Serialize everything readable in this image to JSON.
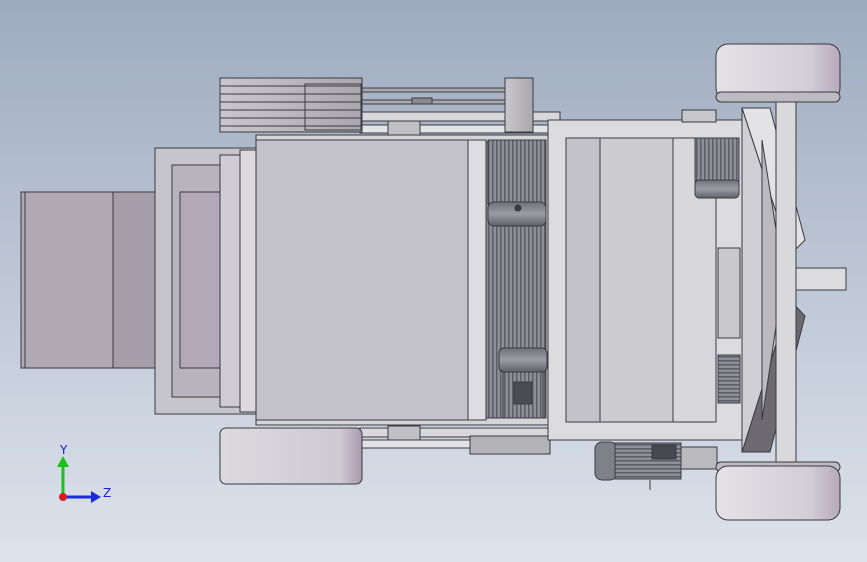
{
  "triad": {
    "y_label": "Y",
    "z_label": "Z",
    "colors": {
      "y": "#19c219",
      "z": "#1b2bd9",
      "x": "#d81b1b"
    }
  },
  "colors": {
    "background_top": "#9eabbf",
    "background_bottom": "#dde3ec",
    "body_fill": "#c9c9cf",
    "body_fill_dark": "#a9a2ad",
    "motor_fill": "#7d8088",
    "wheel_fill": "#d7d3da",
    "outline": "#3a3a40"
  }
}
